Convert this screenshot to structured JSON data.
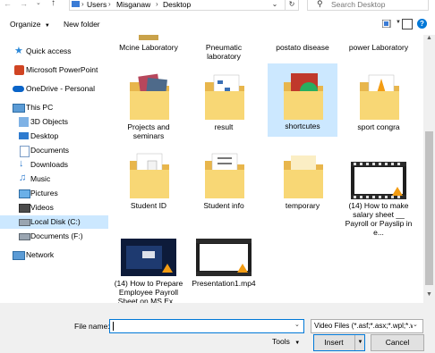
{
  "address": {
    "path": [
      "Users",
      "Misganaw",
      "Desktop"
    ],
    "search_placeholder": "Search Desktop"
  },
  "toolbar": {
    "organize_label": "Organize",
    "new_folder_label": "New folder"
  },
  "nav": {
    "quick_access": "Quick access",
    "items": [
      {
        "label": "Microsoft PowerPoint",
        "icon": "powerpoint-icon"
      },
      {
        "label": "OneDrive - Personal",
        "icon": "onedrive-icon"
      },
      {
        "label": "This PC",
        "icon": "computer-icon"
      },
      {
        "label": "3D Objects",
        "icon": "3d-objects-icon"
      },
      {
        "label": "Desktop",
        "icon": "desktop-icon"
      },
      {
        "label": "Documents",
        "icon": "documents-icon"
      },
      {
        "label": "Downloads",
        "icon": "downloads-icon"
      },
      {
        "label": "Music",
        "icon": "music-icon"
      },
      {
        "label": "Pictures",
        "icon": "pictures-icon"
      },
      {
        "label": "Videos",
        "icon": "videos-icon"
      },
      {
        "label": "Local Disk (C:)",
        "icon": "drive-icon"
      },
      {
        "label": "Documents (F:)",
        "icon": "drive-icon"
      },
      {
        "label": "Network",
        "icon": "network-icon"
      }
    ]
  },
  "files": {
    "row0": [
      "Mcine Laboratory",
      "Pneumatic laboratory",
      "postato disease",
      "power Laboratory"
    ],
    "row1": [
      "Projects and seminars",
      "result",
      "shortcutes",
      "sport congra"
    ],
    "row2": [
      "Student ID",
      "Student info",
      "temporary",
      "(14) How to make salary sheet __ Payroll or Payslip in e..."
    ],
    "row3": [
      "(14) How to Prepare Employee Payroll Sheet on MS Ex...",
      "Presentation1.mp4"
    ]
  },
  "bottom": {
    "file_name_label": "File name:",
    "file_name_value": "",
    "filter_value": "Video Files (*.asf;*.asx;*.wpl;*.w",
    "tools_label": "Tools",
    "insert_label": "Insert",
    "cancel_label": "Cancel"
  },
  "colors": {
    "selection": "#cce8ff",
    "accent": "#0078d7",
    "folder": "#f8d775"
  }
}
